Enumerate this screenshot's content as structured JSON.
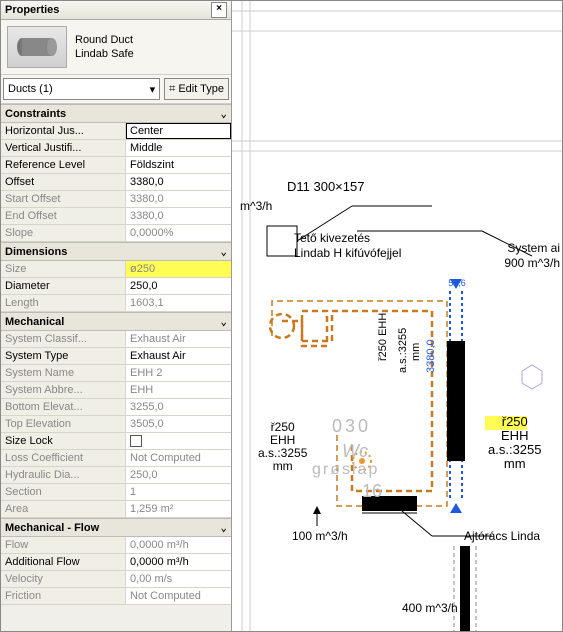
{
  "panel": {
    "title": "Properties",
    "type_family": "Round Duct",
    "type_name": "Lindab Safe",
    "selector": "Ducts (1)",
    "edit_type": "Edit Type",
    "groups": [
      {
        "name": "Constraints",
        "rows": [
          {
            "label": "Horizontal Jus...",
            "value": "Center",
            "mode": "editable"
          },
          {
            "label": "Vertical Justifi...",
            "value": "Middle",
            "mode": "normal"
          },
          {
            "label": "Reference Level",
            "value": "Földszint",
            "mode": "normal"
          },
          {
            "label": "Offset",
            "value": "3380,0",
            "mode": "normal"
          },
          {
            "label": "Start Offset",
            "value": "3380,0",
            "mode": "readonly"
          },
          {
            "label": "End Offset",
            "value": "3380,0",
            "mode": "readonly"
          },
          {
            "label": "Slope",
            "value": "0,0000%",
            "mode": "readonly"
          }
        ]
      },
      {
        "name": "Dimensions",
        "rows": [
          {
            "label": "Size",
            "value": "ø250",
            "mode": "readonly",
            "highlight": true
          },
          {
            "label": "Diameter",
            "value": "250,0",
            "mode": "normal"
          },
          {
            "label": "Length",
            "value": "1603,1",
            "mode": "readonly"
          }
        ]
      },
      {
        "name": "Mechanical",
        "rows": [
          {
            "label": "System Classif...",
            "value": "Exhaust Air",
            "mode": "readonly"
          },
          {
            "label": "System Type",
            "value": "Exhaust Air",
            "mode": "normal"
          },
          {
            "label": "System Name",
            "value": "EHH 2",
            "mode": "readonly"
          },
          {
            "label": "System Abbre...",
            "value": "EHH",
            "mode": "readonly"
          },
          {
            "label": "Bottom Elevat...",
            "value": "3255,0",
            "mode": "readonly"
          },
          {
            "label": "Top Elevation",
            "value": "3505,0",
            "mode": "readonly"
          },
          {
            "label": "Size Lock",
            "value": "",
            "mode": "normal",
            "checkbox": true
          },
          {
            "label": "Loss Coefficient",
            "value": "Not Computed",
            "mode": "readonly"
          },
          {
            "label": "Hydraulic Dia...",
            "value": "250,0",
            "mode": "readonly"
          },
          {
            "label": "Section",
            "value": "1",
            "mode": "readonly"
          },
          {
            "label": "Area",
            "value": "1,259 m²",
            "mode": "readonly"
          }
        ]
      },
      {
        "name": "Mechanical - Flow",
        "rows": [
          {
            "label": "Flow",
            "value": "0,0000 m³/h",
            "mode": "readonly"
          },
          {
            "label": "Additional Flow",
            "value": "0,0000 m³/h",
            "mode": "normal"
          },
          {
            "label": "Velocity",
            "value": "0,00 m/s",
            "mode": "readonly"
          },
          {
            "label": "Friction",
            "value": "Not Computed",
            "mode": "readonly"
          }
        ]
      }
    ]
  },
  "canvas": {
    "labels": {
      "d11": "D11 300×157",
      "m3h_top": "m^3/h",
      "teto": "Tető kivezetés",
      "lindab_h": "Lindab H kifúvófejjel",
      "system_air": "System ai",
      "flow_900": "900 m^3/h",
      "r250_left": "ř250",
      "ehh_left": "EHH",
      "as_left": "a.s.:3255",
      "mm_left": "mm",
      "dim_030": "030",
      "r250_mid_v": "ř250",
      "ehh_mid": "EHH",
      "as_mid": "a.s.:3255",
      "mm_mid": "mm",
      "dim_3380": "3380,0",
      "dim_51_6": "51,6",
      "wc": "Wc",
      "groslap": "grøslap",
      "dim_16": "16",
      "flow_100": "100 m^3/h",
      "ajtoracs": "Ajtórács Linda",
      "r250_right": "ř250",
      "ehh_right": "EHH",
      "as_right": "a.s.:3255",
      "mm_right": "mm",
      "flow_400": "400 m^3/h"
    }
  }
}
